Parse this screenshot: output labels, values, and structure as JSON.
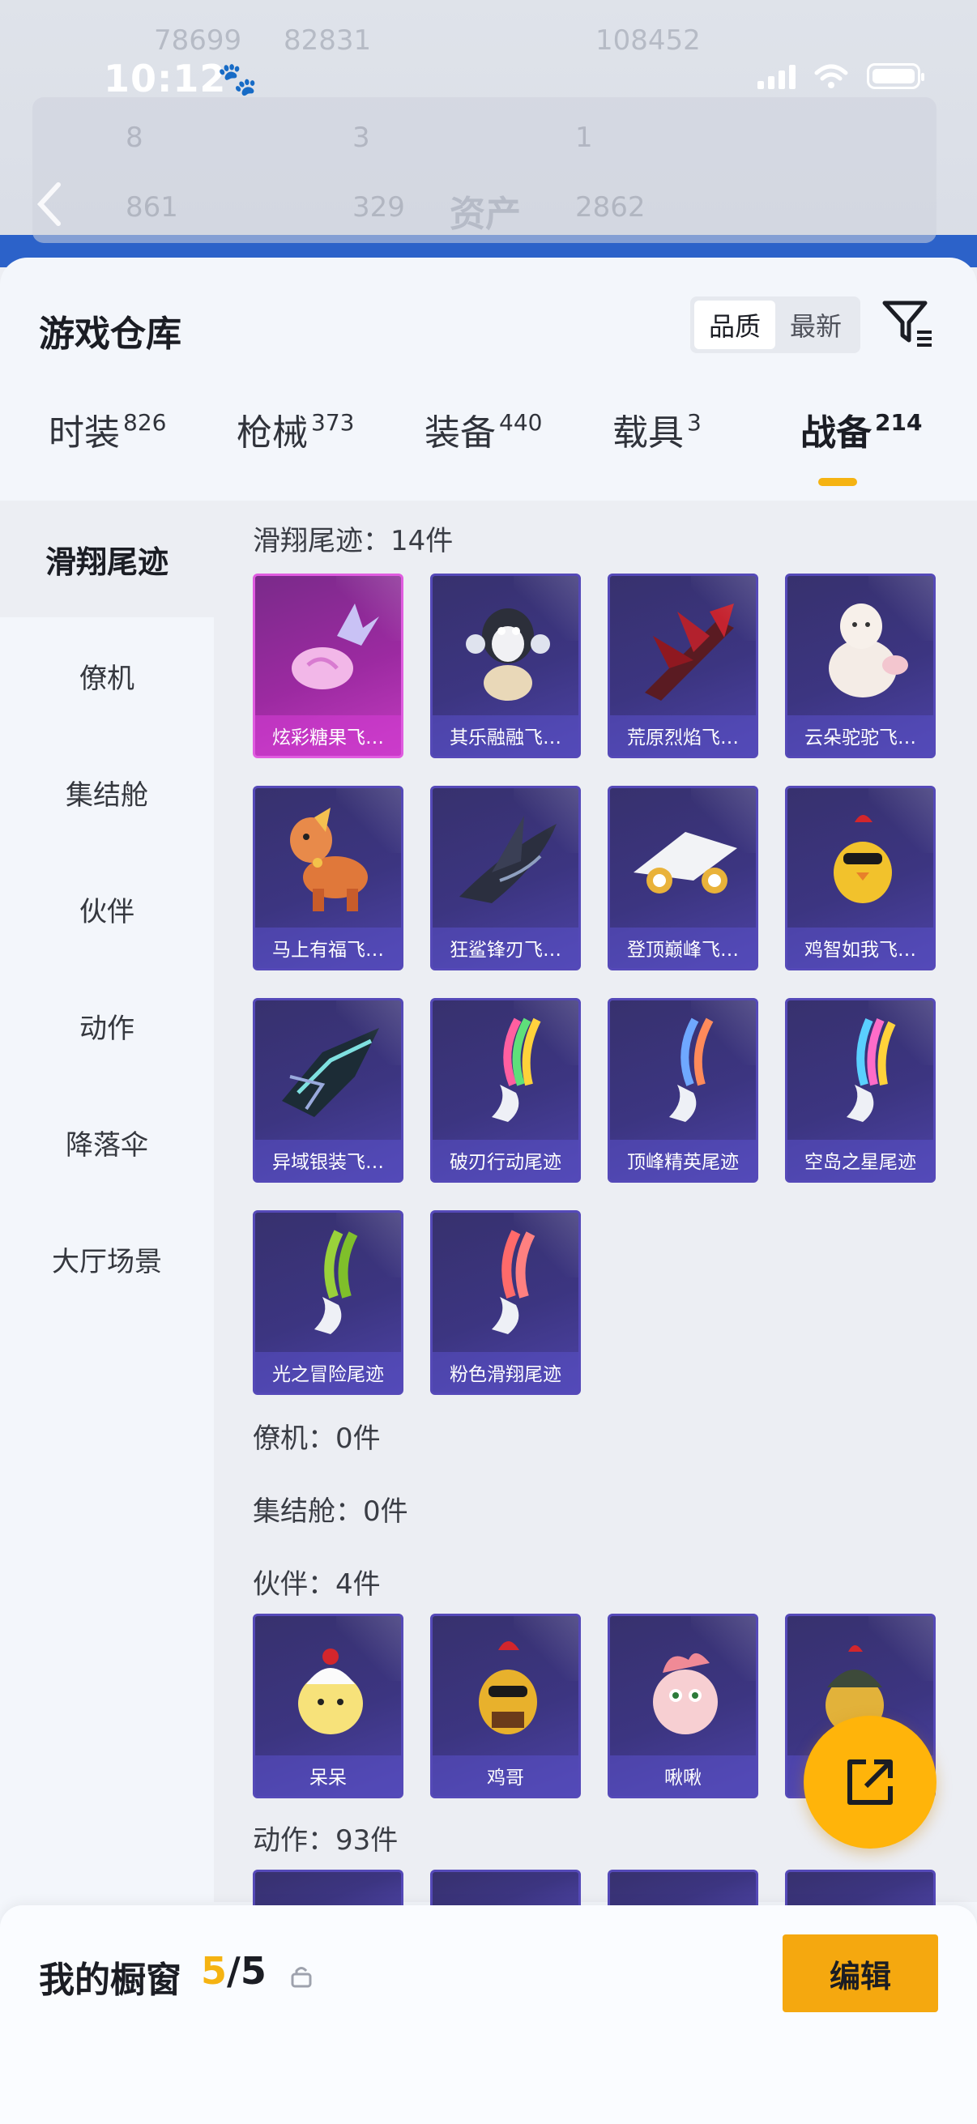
{
  "status_bar": {
    "time": "10:12",
    "paw": "🐾"
  },
  "background": {
    "title": "资产",
    "faint_values": [
      "78699",
      "82831",
      "108452",
      "8",
      "3",
      "1",
      "861",
      "329",
      "2862"
    ]
  },
  "sheet": {
    "title": "游戏仓库",
    "sort": {
      "quality": "品质",
      "latest": "最新"
    }
  },
  "tabs": [
    {
      "label": "时装",
      "count": "826"
    },
    {
      "label": "枪械",
      "count": "373"
    },
    {
      "label": "装备",
      "count": "440"
    },
    {
      "label": "载具",
      "count": "3"
    },
    {
      "label": "战备",
      "count": "214"
    }
  ],
  "sidebar": [
    "滑翔尾迹",
    "僚机",
    "集结舱",
    "伙伴",
    "动作",
    "降落伞",
    "大厅场景"
  ],
  "sections": {
    "glide": {
      "label": "滑翔尾迹：14件"
    },
    "wingman": {
      "label": "僚机：0件"
    },
    "pod": {
      "label": "集结舱：0件"
    },
    "partner": {
      "label": "伙伴：4件"
    },
    "emote": {
      "label": "动作：93件"
    }
  },
  "glide_items": [
    "炫彩糖果飞…",
    "其乐融融飞…",
    "荒原烈焰飞…",
    "云朵驼驼飞…",
    "马上有福飞…",
    "狂鲨锋刃飞…",
    "登顶巅峰飞…",
    "鸡智如我飞…",
    "异域银装飞…",
    "破刃行动尾迹",
    "顶峰精英尾迹",
    "空岛之星尾迹",
    "光之冒险尾迹",
    "粉色滑翔尾迹"
  ],
  "partner_items": [
    "呆呆",
    "鸡哥",
    "啾啾",
    ""
  ],
  "showcase": {
    "label": "我的橱窗",
    "current": "5",
    "sep": "/",
    "total": "5"
  },
  "edit_label": "编辑",
  "colors": {
    "accent": "#f5b312",
    "card": "#3c3581",
    "rare_card": "#c33bc0"
  }
}
